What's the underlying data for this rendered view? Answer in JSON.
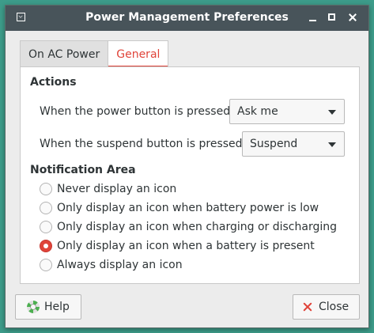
{
  "window": {
    "title": "Power Management Preferences"
  },
  "tabs": [
    {
      "label": "On AC Power",
      "active": false
    },
    {
      "label": "General",
      "active": true
    }
  ],
  "actions": {
    "heading": "Actions",
    "power_button": {
      "label": "When the power button is pressed:",
      "value": "Ask me"
    },
    "suspend_button": {
      "label": "When the suspend button is pressed:",
      "value": "Suspend"
    }
  },
  "notification": {
    "heading": "Notification Area",
    "options": [
      {
        "label": "Never display an icon",
        "checked": false
      },
      {
        "label": "Only display an icon when battery power is low",
        "checked": false
      },
      {
        "label": "Only display an icon when charging or discharging",
        "checked": false
      },
      {
        "label": "Only display an icon when a battery is present",
        "checked": true
      },
      {
        "label": "Always display an icon",
        "checked": false
      }
    ]
  },
  "buttons": {
    "help": {
      "label": "Help",
      "icon": "help-icon"
    },
    "close": {
      "label": "Close",
      "icon": "close-icon"
    }
  },
  "colors": {
    "accent": "#e0443a",
    "titlebar": "#48545a",
    "desktop": "#3d9c8a"
  }
}
